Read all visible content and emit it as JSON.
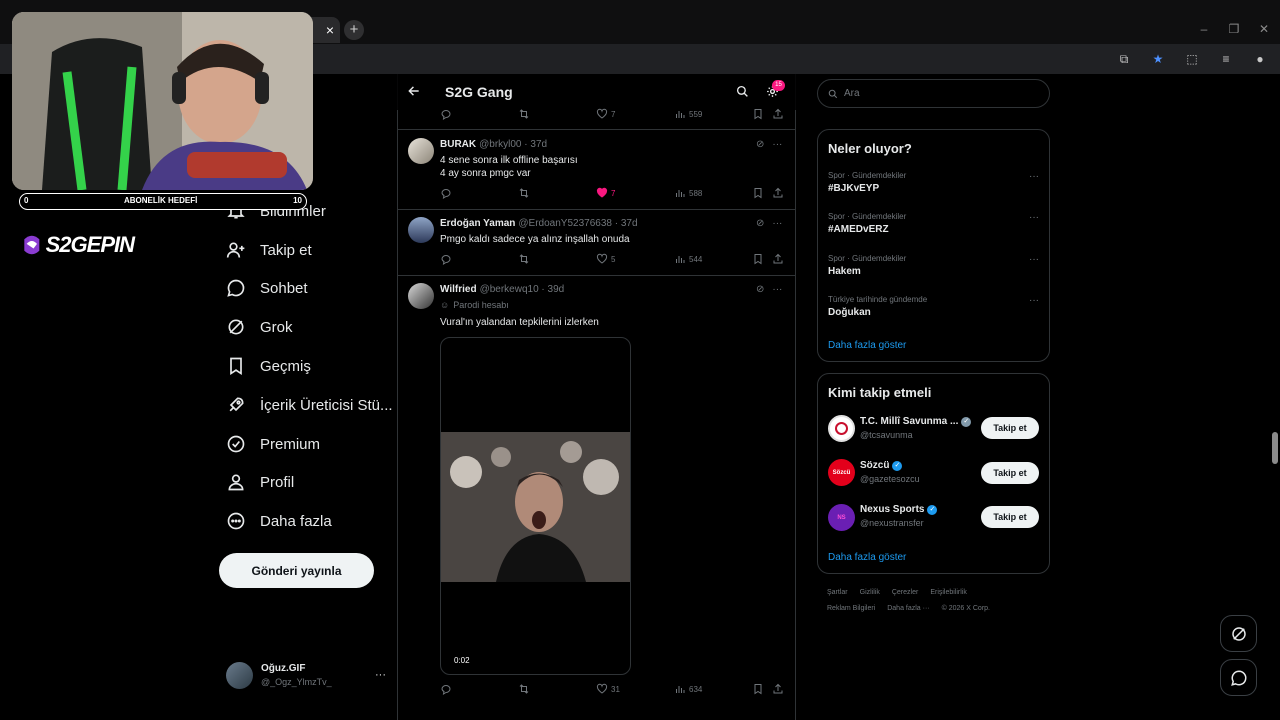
{
  "browser": {
    "tab_close_glyph": "×",
    "new_tab_glyph": "+",
    "window_controls": [
      "–",
      "❐",
      "✕"
    ]
  },
  "stream": {
    "goal_label": "ABONELİK HEDEFİ",
    "goal_min": "0",
    "goal_max": "10",
    "logo_text": "S2GEPIN"
  },
  "nav": {
    "items": [
      {
        "label": "Bildirimler",
        "icon": "bell-icon",
        "badge": "2"
      },
      {
        "label": "Takip et",
        "icon": "follow-icon"
      },
      {
        "label": "Sohbet",
        "icon": "chat-icon"
      },
      {
        "label": "Grok",
        "icon": "grok-icon"
      },
      {
        "label": "Geçmiş",
        "icon": "bookmark-icon"
      },
      {
        "label": "İçerik Üreticisi Stü...",
        "icon": "rocket-icon"
      },
      {
        "label": "Premium",
        "icon": "premium-icon"
      },
      {
        "label": "Profil",
        "icon": "person-icon"
      },
      {
        "label": "Daha fazla",
        "icon": "more-icon"
      }
    ],
    "post_button": "Gönderi yayınla",
    "profile": {
      "name": "Oğuz.GIF",
      "handle": "@_Ogz_YlmzTv_",
      "more": "···"
    }
  },
  "timeline": {
    "title": "S2G Gang",
    "settings_badge": "15",
    "top_stats": {
      "replies": "",
      "reposts": "",
      "likes": "7",
      "views": "559"
    },
    "tweets": [
      {
        "name": "BURAK",
        "handle": "@brkyl00 · 37d",
        "lines": [
          "4 sene sonra ilk offline başarısı",
          "4 ay sonra pmgc var"
        ],
        "likes": "7",
        "views": "588",
        "liked": true
      },
      {
        "name": "Erdoğan Yaman",
        "handle": "@ErdoanY52376638 · 37d",
        "lines": [
          "Pmgo kaldı sadece ya alınz inşallah onuda"
        ],
        "likes": "5",
        "views": "544",
        "liked": false
      },
      {
        "name": "Wilfried",
        "handle": "@berkewq10 · 39d",
        "sublabel": "Parodi hesabı",
        "lines": [
          "Vural'ın yalandan tepkilerini izlerken"
        ],
        "likes": "31",
        "views": "634",
        "liked": false,
        "video_time": "0:02"
      }
    ]
  },
  "sidebar": {
    "search_placeholder": "Ara",
    "trends_title": "Neler oluyor?",
    "trends": [
      {
        "meta": "Spor · Gündemdekiler",
        "name": "#BJKvEYP"
      },
      {
        "meta": "Spor · Gündemdekiler",
        "name": "#AMEDvERZ"
      },
      {
        "meta": "Spor · Gündemdekiler",
        "name": "Hakem"
      },
      {
        "meta": "Türkiye tarihinde gündemde",
        "name": "Doğukan"
      }
    ],
    "trends_more": "Daha fazla göster",
    "who_title": "Kimi takip etmeli",
    "who": [
      {
        "name": "T.C. Millî Savunma ...",
        "handle": "@tcsavunma",
        "verified": "gray",
        "button": "Takip et"
      },
      {
        "name": "Sözcü",
        "handle": "@gazetesozcu",
        "verified": "blue",
        "button": "Takip et"
      },
      {
        "name": "Nexus Sports",
        "handle": "@nexustransfer",
        "verified": "blue",
        "button": "Takip et"
      }
    ],
    "who_more": "Daha fazla göster",
    "footer_row1": [
      "Şartlar",
      "Gizlilik",
      "Çerezler",
      "Erişilebilirlik"
    ],
    "footer_row2": [
      "Reklam Bilgileri",
      "Daha fazla ···",
      "© 2026 X Corp."
    ]
  },
  "colors": {
    "accent": "#1d9bf0",
    "like": "#f91880",
    "background": "#000000"
  }
}
